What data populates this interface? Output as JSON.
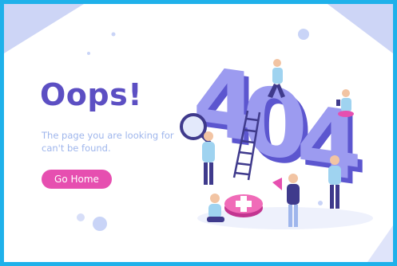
{
  "error_page": {
    "heading": "Oops!",
    "message": "The page you are looking for can't be found.",
    "home_button_label": "Go Home",
    "illustration_text": "404"
  },
  "colors": {
    "frame_border": "#1fb1ea",
    "heading": "#5c4fc3",
    "message": "#9fb6ec",
    "button": "#e64fb0",
    "digit_face": "#9c9bf0",
    "digit_side": "#5c56cf",
    "decor_circle": "#c9d4f7"
  },
  "icons": [
    "magnifying-glass-icon",
    "ladder-icon",
    "first-aid-cross-icon",
    "megaphone-icon"
  ]
}
